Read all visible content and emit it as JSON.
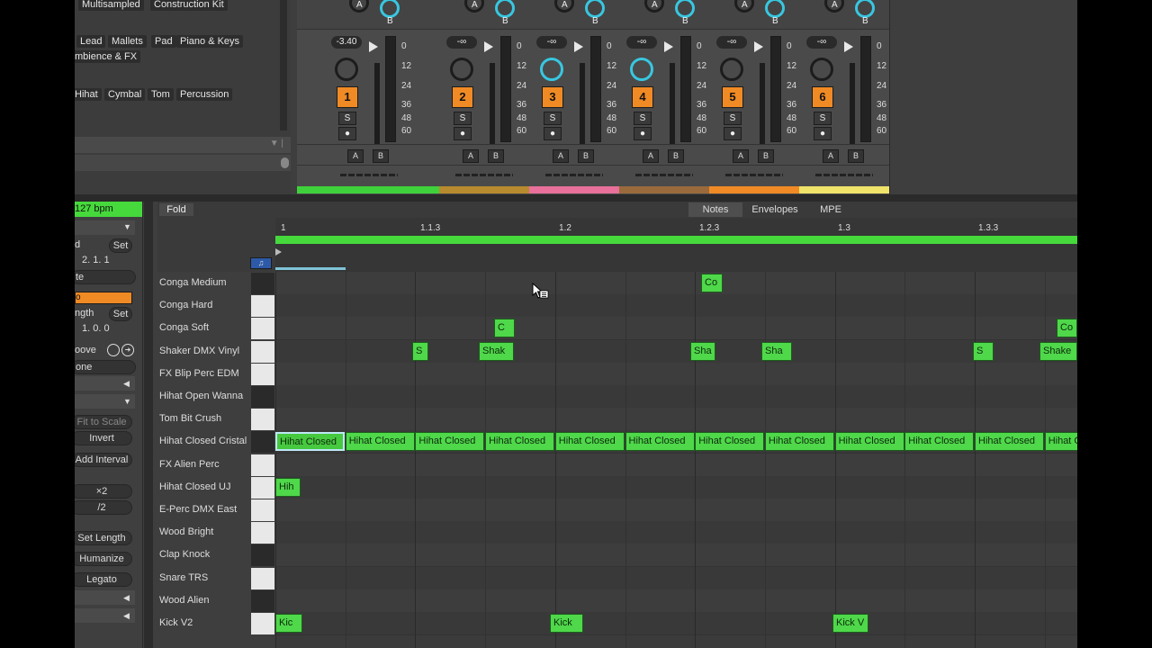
{
  "browser": {
    "tags_row1": [
      "Multisampled",
      "Construction Kit"
    ],
    "tags_row2": [
      "Lead",
      "Mallets",
      "Pad",
      "Piano & Keys"
    ],
    "tags_row2b": [
      "mbience & FX"
    ],
    "tags_row3": [
      "Hihat",
      "Cymbal",
      "Tom",
      "Percussion"
    ]
  },
  "mixer": {
    "tracks": [
      {
        "num": "1",
        "volume": "-3.40",
        "color": "#3fd13b"
      },
      {
        "num": "2",
        "volume": "-∞",
        "color": "#b88a2e"
      },
      {
        "num": "3",
        "volume": "-∞",
        "color": "#e8709a"
      },
      {
        "num": "4",
        "volume": "-∞",
        "color": "#9a6a3c"
      },
      {
        "num": "5",
        "volume": "-∞",
        "color": "#f08a24"
      },
      {
        "num": "6",
        "volume": "-∞",
        "color": "#efe36a"
      }
    ],
    "send_a": "A",
    "send_b": "B",
    "solo": "S",
    "db_scale": [
      "0",
      "12",
      "24",
      "36",
      "48",
      "60"
    ]
  },
  "clip_panel": {
    "tempo": "127 bpm",
    "start_label": "d",
    "set_label": "Set",
    "position": "2.  1.  1",
    "loop_label": "te",
    "o_label": "o",
    "length_label": "ngth",
    "set_label2": "Set",
    "length_value": "1.  0.  0",
    "groove_label": "oove",
    "none_label": "one",
    "fit_to_scale": "Fit to Scale",
    "invert": "Invert",
    "add_interval": "Add Interval",
    "double": "×2",
    "half": "/2",
    "set_length": "Set Length",
    "humanize": "Humanize",
    "legato": "Legato"
  },
  "piano_roll": {
    "fold_label": "Fold",
    "tabs": [
      "Notes",
      "Envelopes",
      "MPE"
    ],
    "ruler": [
      "1",
      "1.1.3",
      "1.2",
      "1.2.3",
      "1.3",
      "1.3.3"
    ],
    "lanes": [
      "Conga Medium",
      "Conga Hard",
      "Conga Soft",
      "Shaker DMX Vinyl",
      "FX Blip Perc EDM",
      "Hihat Open Wanna",
      "Tom Bit Crush",
      "Hihat Closed Cristal",
      "FX Alien Perc",
      "Hihat Closed UJ",
      "E-Perc DMX East",
      "Wood Bright",
      "Clap Knock",
      "Snare TRS",
      "Wood Alien",
      "Kick V2"
    ],
    "notes": {
      "conga_medium": [
        "Co"
      ],
      "conga_soft": [
        "C",
        "Co"
      ],
      "shaker": [
        "S",
        "Shak",
        "Sha",
        "Sha",
        "S",
        "Shake"
      ],
      "hihat_closed": [
        "Hihat Closed",
        "Hihat Closed",
        "Hihat Closed",
        "Hihat Closed",
        "Hihat Closed",
        "Hihat Closed",
        "Hihat Closed",
        "Hihat Closed",
        "Hihat Closed",
        "Hihat Closed",
        "Hihat Closed",
        "Hihat C"
      ],
      "hihat_uj": [
        "Hih"
      ],
      "kick": [
        "Kic",
        "Kick",
        "Kick V"
      ]
    }
  },
  "colors": {
    "note_green": "#4fd84a",
    "loop_green": "#46d93c",
    "track_orange": "#f08a24"
  }
}
